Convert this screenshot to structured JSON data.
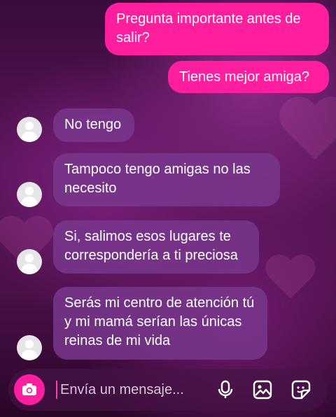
{
  "messages": {
    "sent": [
      {
        "text": "Pregunta importante antes de salir?"
      },
      {
        "text": "Tienes mejor amiga?"
      }
    ],
    "received": [
      {
        "text": "No tengo"
      },
      {
        "text": "Tampoco tengo amigas no las necesito"
      },
      {
        "text": "Si, salimos esos lugares te correspondería a ti preciosa"
      },
      {
        "text": "Serás mi centro de atención tú y mi mamá serían las únicas reinas de mi vida"
      }
    ]
  },
  "composer": {
    "placeholder": "Envía un mensaje..."
  },
  "icons": {
    "camera": "camera-icon",
    "mic": "microphone-icon",
    "gallery": "image-gallery-icon",
    "sticker": "sticker-icon"
  },
  "colors": {
    "sent_bubble": "#ff1f9e",
    "received_bubble": "#78378c",
    "accent": "#ff1f9e"
  }
}
